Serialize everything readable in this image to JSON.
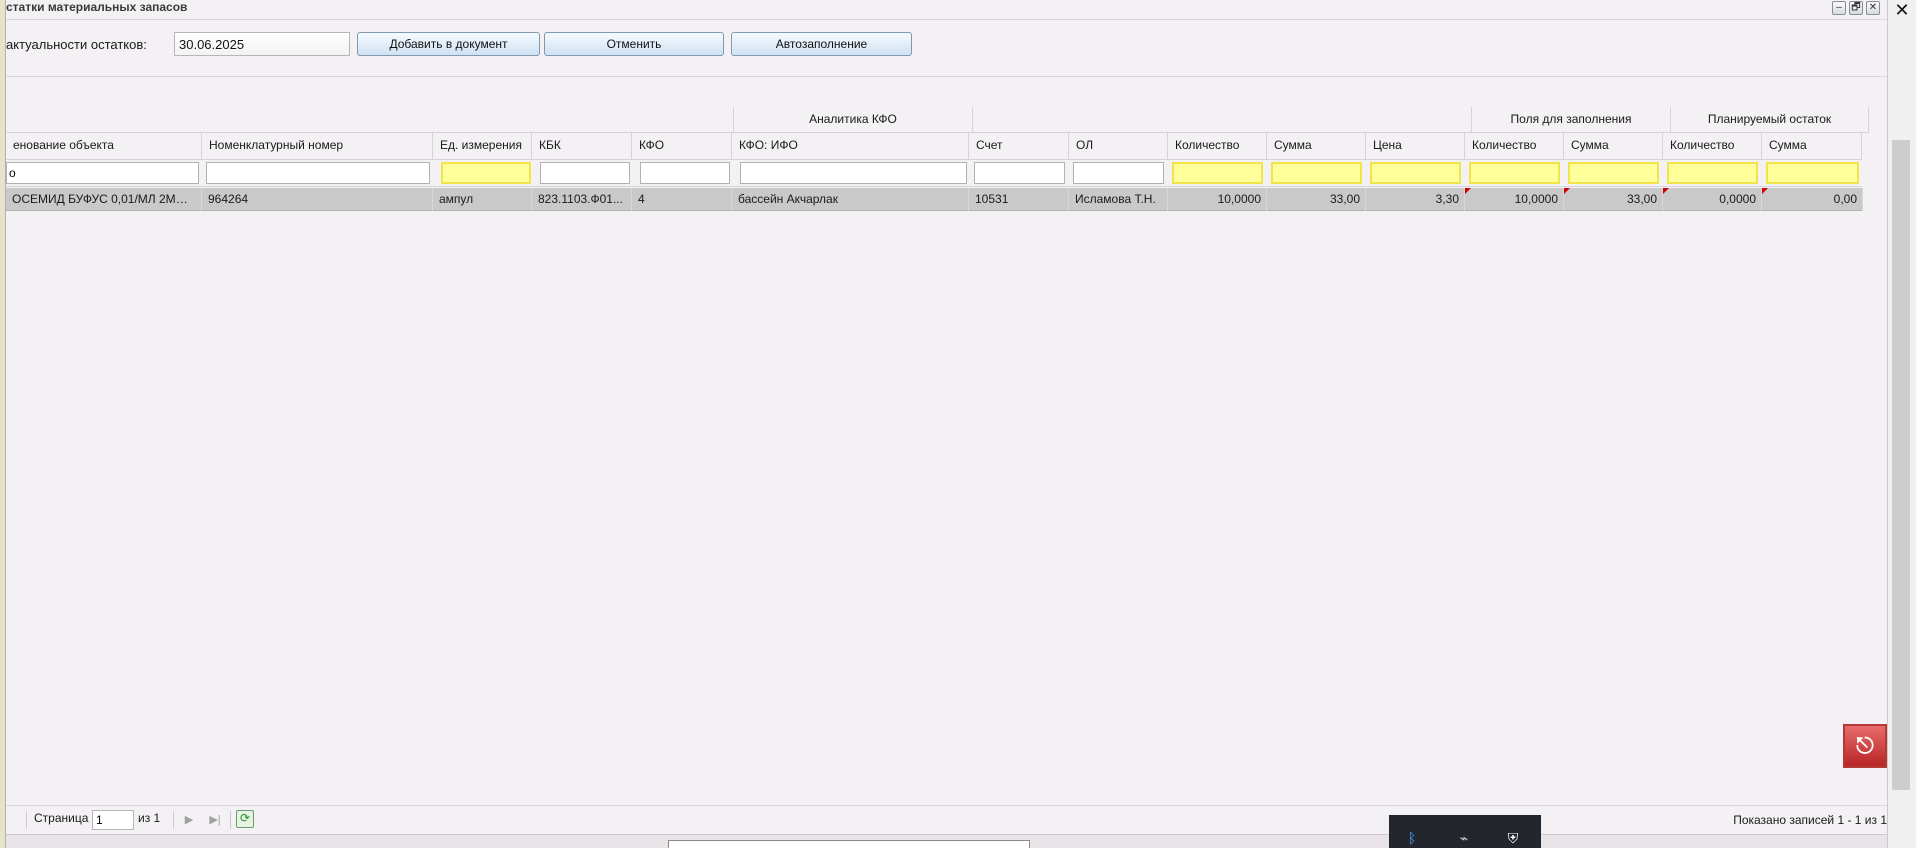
{
  "window": {
    "title": "статки материальных запасов",
    "controls": [
      "‒",
      "🗗",
      "✕"
    ]
  },
  "toolbar": {
    "date_label": "актуальности остатков:",
    "date_value": "30.06.2025",
    "add_label": "Добавить в документ",
    "cancel_label": "Отменить",
    "autofill_label": "Автозаполнение"
  },
  "grid": {
    "groups": [
      "Аналитика КФО",
      "Поля для заполнения",
      "Планируемый остаток"
    ],
    "columns": [
      "енование объекта",
      "Номенклатурный номер",
      "Ед. измерения",
      "КБК",
      "КФО",
      "КФО: ИФО",
      "Счет",
      "ОЛ",
      "Количество",
      "Сумма",
      "Цена",
      "Количество",
      "Сумма",
      "Количество",
      "Сумма"
    ],
    "filter_first_value": "о",
    "row": [
      "ОСЕМИД БУФУС 0,01/МЛ 2МЛ М...",
      "964264",
      "ампул",
      "823.1103.Ф01...",
      "4",
      "бассейн Акчарлак",
      "10531",
      "Исламова Т.Н.",
      "10,0000",
      "33,00",
      "3,30",
      "10,0000",
      "33,00",
      "0,0000",
      "0,00"
    ]
  },
  "pager": {
    "page_label": "Страница",
    "page_value": "1",
    "of_label": "из 1",
    "records_label": "Показано записей 1 - 1 из 1"
  },
  "icons": {
    "refresh": "refresh-icon",
    "app": "app-shortcut-icon",
    "tray": [
      "bluetooth-icon",
      "network-icon",
      "security-shield-icon"
    ]
  },
  "colors": {
    "filter_highlight": "#ffff99",
    "row_selected": "#c9c9c9",
    "dirty_marker": "#d10000",
    "button_gradient_end": "#cfe1f1"
  }
}
